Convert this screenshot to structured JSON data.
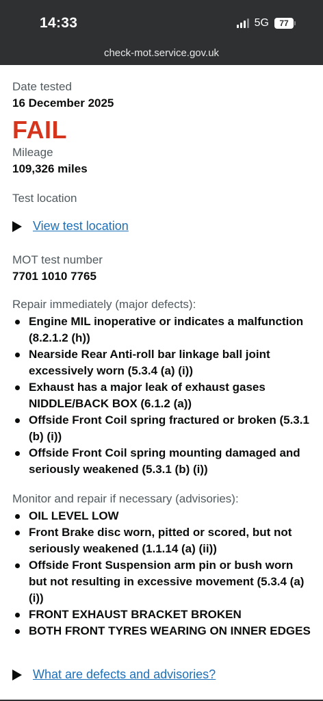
{
  "status_bar": {
    "time": "14:33",
    "network": "5G",
    "battery": "77"
  },
  "browser": {
    "url": "check-mot.service.gov.uk"
  },
  "result": {
    "date_label": "Date tested",
    "date_value": "16 December 2025",
    "status": "FAIL",
    "mileage_label": "Mileage",
    "mileage_value": "109,326 miles",
    "location_label": "Test location",
    "location_link": "View test location",
    "test_number_label": "MOT test number",
    "test_number_value": "7701 1010 7765"
  },
  "major_defects": {
    "heading": "Repair immediately (major defects):",
    "items": [
      "Engine MIL inoperative or indicates a malfunction (8.2.1.2 (h))",
      "Nearside Rear Anti-roll bar linkage ball joint excessively worn (5.3.4 (a) (i))",
      "Exhaust has a major leak of exhaust gases NIDDLE/BACK BOX (6.1.2 (a))",
      "Offside Front Coil spring fractured or broken (5.3.1 (b) (i))",
      "Offside Front Coil spring mounting damaged and seriously weakened (5.3.1 (b) (i))"
    ]
  },
  "advisories": {
    "heading": "Monitor and repair if necessary (advisories):",
    "items": [
      "OIL LEVEL LOW",
      "Front Brake disc worn, pitted or scored, but not seriously weakened (1.1.14 (a) (ii))",
      "Offside Front Suspension arm pin or bush worn but not resulting in excessive movement (5.3.4 (a) (i))",
      "FRONT EXHAUST BRACKET BROKEN",
      "BOTH FRONT TYRES WEARING ON INNER EDGES"
    ]
  },
  "help_link": "What are defects and advisories?",
  "colors": {
    "fail": "#d4351c",
    "link": "#1d70b8",
    "header_bg": "#2e3032"
  }
}
